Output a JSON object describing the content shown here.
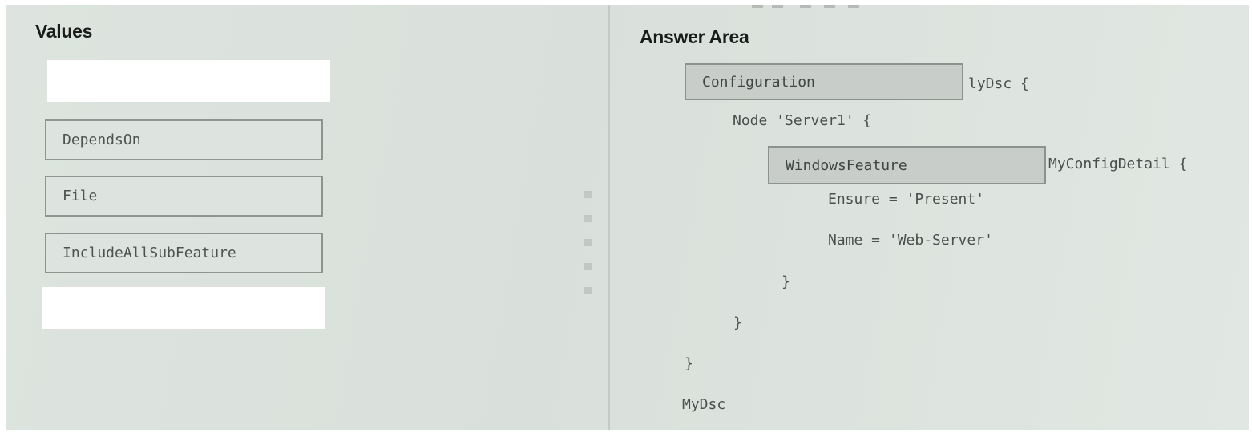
{
  "values": {
    "title": "Values",
    "items": [
      {
        "label": ""
      },
      {
        "label": "DependsOn"
      },
      {
        "label": "File"
      },
      {
        "label": "IncludeAllSubFeature"
      },
      {
        "label": ""
      }
    ]
  },
  "answer_area": {
    "title": "Answer Area",
    "slot_configuration": "Configuration",
    "config_name_suffix": "lyDsc {",
    "node_line": "Node 'Server1' {",
    "slot_resource": "WindowsFeature",
    "resource_name": "MyConfigDetail {",
    "ensure_line": "Ensure = 'Present'",
    "name_line": "Name = 'Web-Server'",
    "close_resource": "}",
    "close_node": "}",
    "close_config": "}",
    "invoke_line": "MyDsc"
  }
}
